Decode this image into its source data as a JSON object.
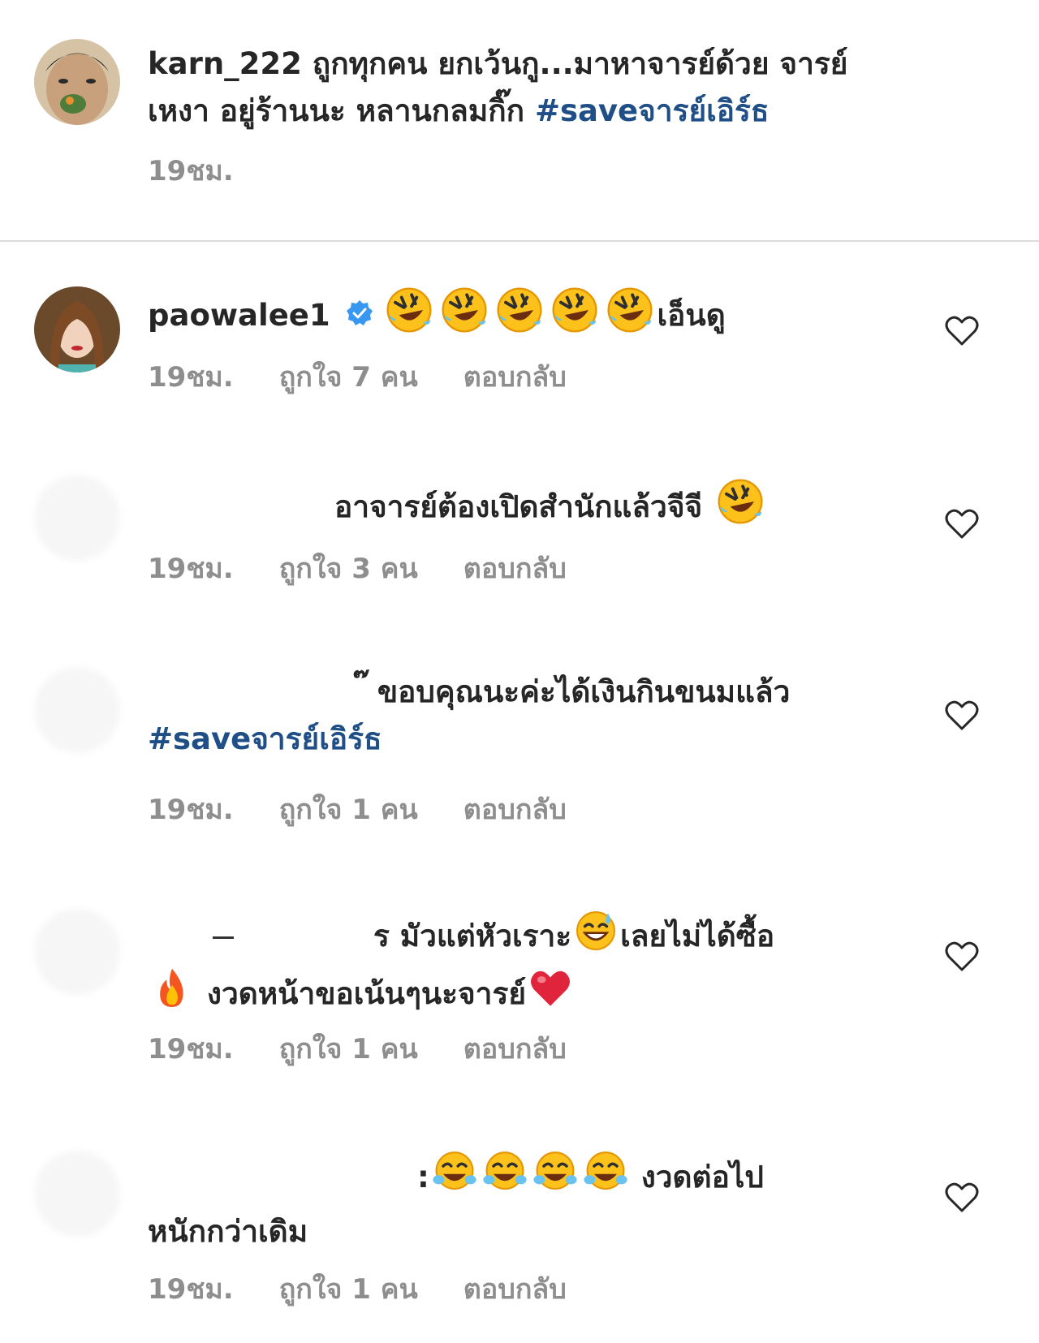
{
  "caption": {
    "username": "karn_222",
    "text": "ถูกทุกคน ยกเว้นกู...มาหาจารย์ด้วย จารย์",
    "text2": "เหงา อยู่ร้านนะ หลานกลมกิ๊ก ",
    "hashtag": "#saveจารย์เอิร์ธ",
    "time": "19ชม."
  },
  "comments": [
    {
      "username": "paowalee1",
      "text": "เอ็นดู",
      "time": "19ชม.",
      "likes": "ถูกใจ 7 คน",
      "reply": "ตอบกลับ"
    },
    {
      "text": "อาจารย์ต้องเปิดสำนักแล้วจีจี ",
      "time": "19ชม.",
      "likes": "ถูกใจ 3 คน",
      "reply": "ตอบกลับ"
    },
    {
      "fragment": "๊",
      "text": "ขอบคุณนะค่ะได้เงินกินขนมแล้ว",
      "hashtag": "#saveจารย์เอิร์ธ",
      "time": "19ชม.",
      "likes": "ถูกใจ 1 คน",
      "reply": "ตอบกลับ"
    },
    {
      "fragment": "ร",
      "text1": "มัวแต่หัวเราะ",
      "text2": "เลยไม่ได้ซื้อ",
      "text3": "งวดหน้าขอเน้นๆนะจารย์",
      "time": "19ชม.",
      "likes": "ถูกใจ 1 คน",
      "reply": "ตอบกลับ"
    },
    {
      "fragment": ":",
      "text1": "งวดต่อไป",
      "text2": "หนักกว่าเดิม",
      "time": "19ชม.",
      "likes": "ถูกใจ 1 คน",
      "reply": "ตอบกลับ"
    }
  ],
  "icons": {
    "verified": "verified-badge-icon",
    "heart": "heart-outline-icon",
    "rofl": "rolling-laughing-emoji",
    "tears": "tears-of-joy-emoji",
    "sweat": "grinning-sweat-emoji",
    "fire": "fire-emoji",
    "red_heart": "red-heart-emoji"
  },
  "colors": {
    "text": "#262626",
    "meta": "#8e8e8e",
    "hashtag": "#1f4f86",
    "verified": "#3897f0"
  }
}
